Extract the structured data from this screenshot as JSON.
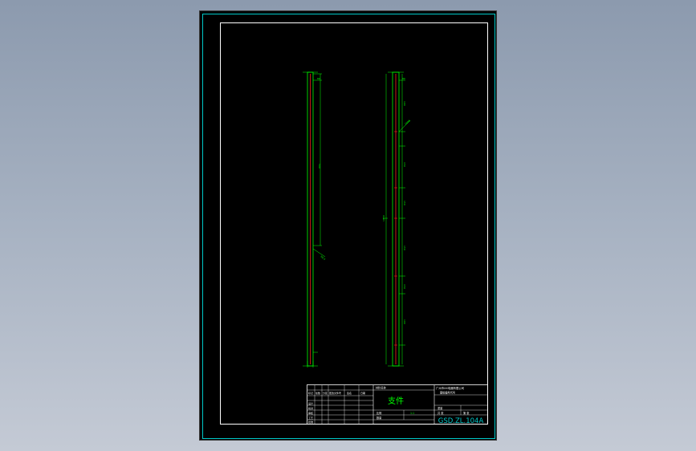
{
  "drawing": {
    "background_color": "#000000",
    "frame_color": "#ffffff",
    "outer_frame_color": "#00c8c8",
    "line_color_green": "#00ff00",
    "line_color_red": "#ff2020",
    "line_color_cyan": "#00ffff"
  },
  "part_views": {
    "left_view": {
      "dim_top": "80",
      "dim_mid": "500",
      "dim_leader": "R0.5"
    },
    "right_view": {
      "dim_top": "80",
      "dim_leader": "2XM6",
      "dim_labels": [
        "100",
        "150",
        "150",
        "1050",
        "150",
        "150",
        "100"
      ]
    }
  },
  "title_block": {
    "company": "广州市XX电器有限公司",
    "company_sub": "图纸编号代号",
    "part_name": "支件",
    "material_label": "材料名称",
    "mark_labels": [
      "标记",
      "处数",
      "分区",
      "更改文件号",
      "签名",
      "日期"
    ],
    "row_labels": [
      "设计",
      "校对",
      "审核",
      "工艺",
      "批准"
    ],
    "scale_label": "比例",
    "weight_label": "重量",
    "sheet_label": "共 张",
    "sheet_label2": "第 张",
    "quantity_label": "数量",
    "scale_value": "1:1",
    "drawing_number": "GSD.ZL.104A"
  }
}
